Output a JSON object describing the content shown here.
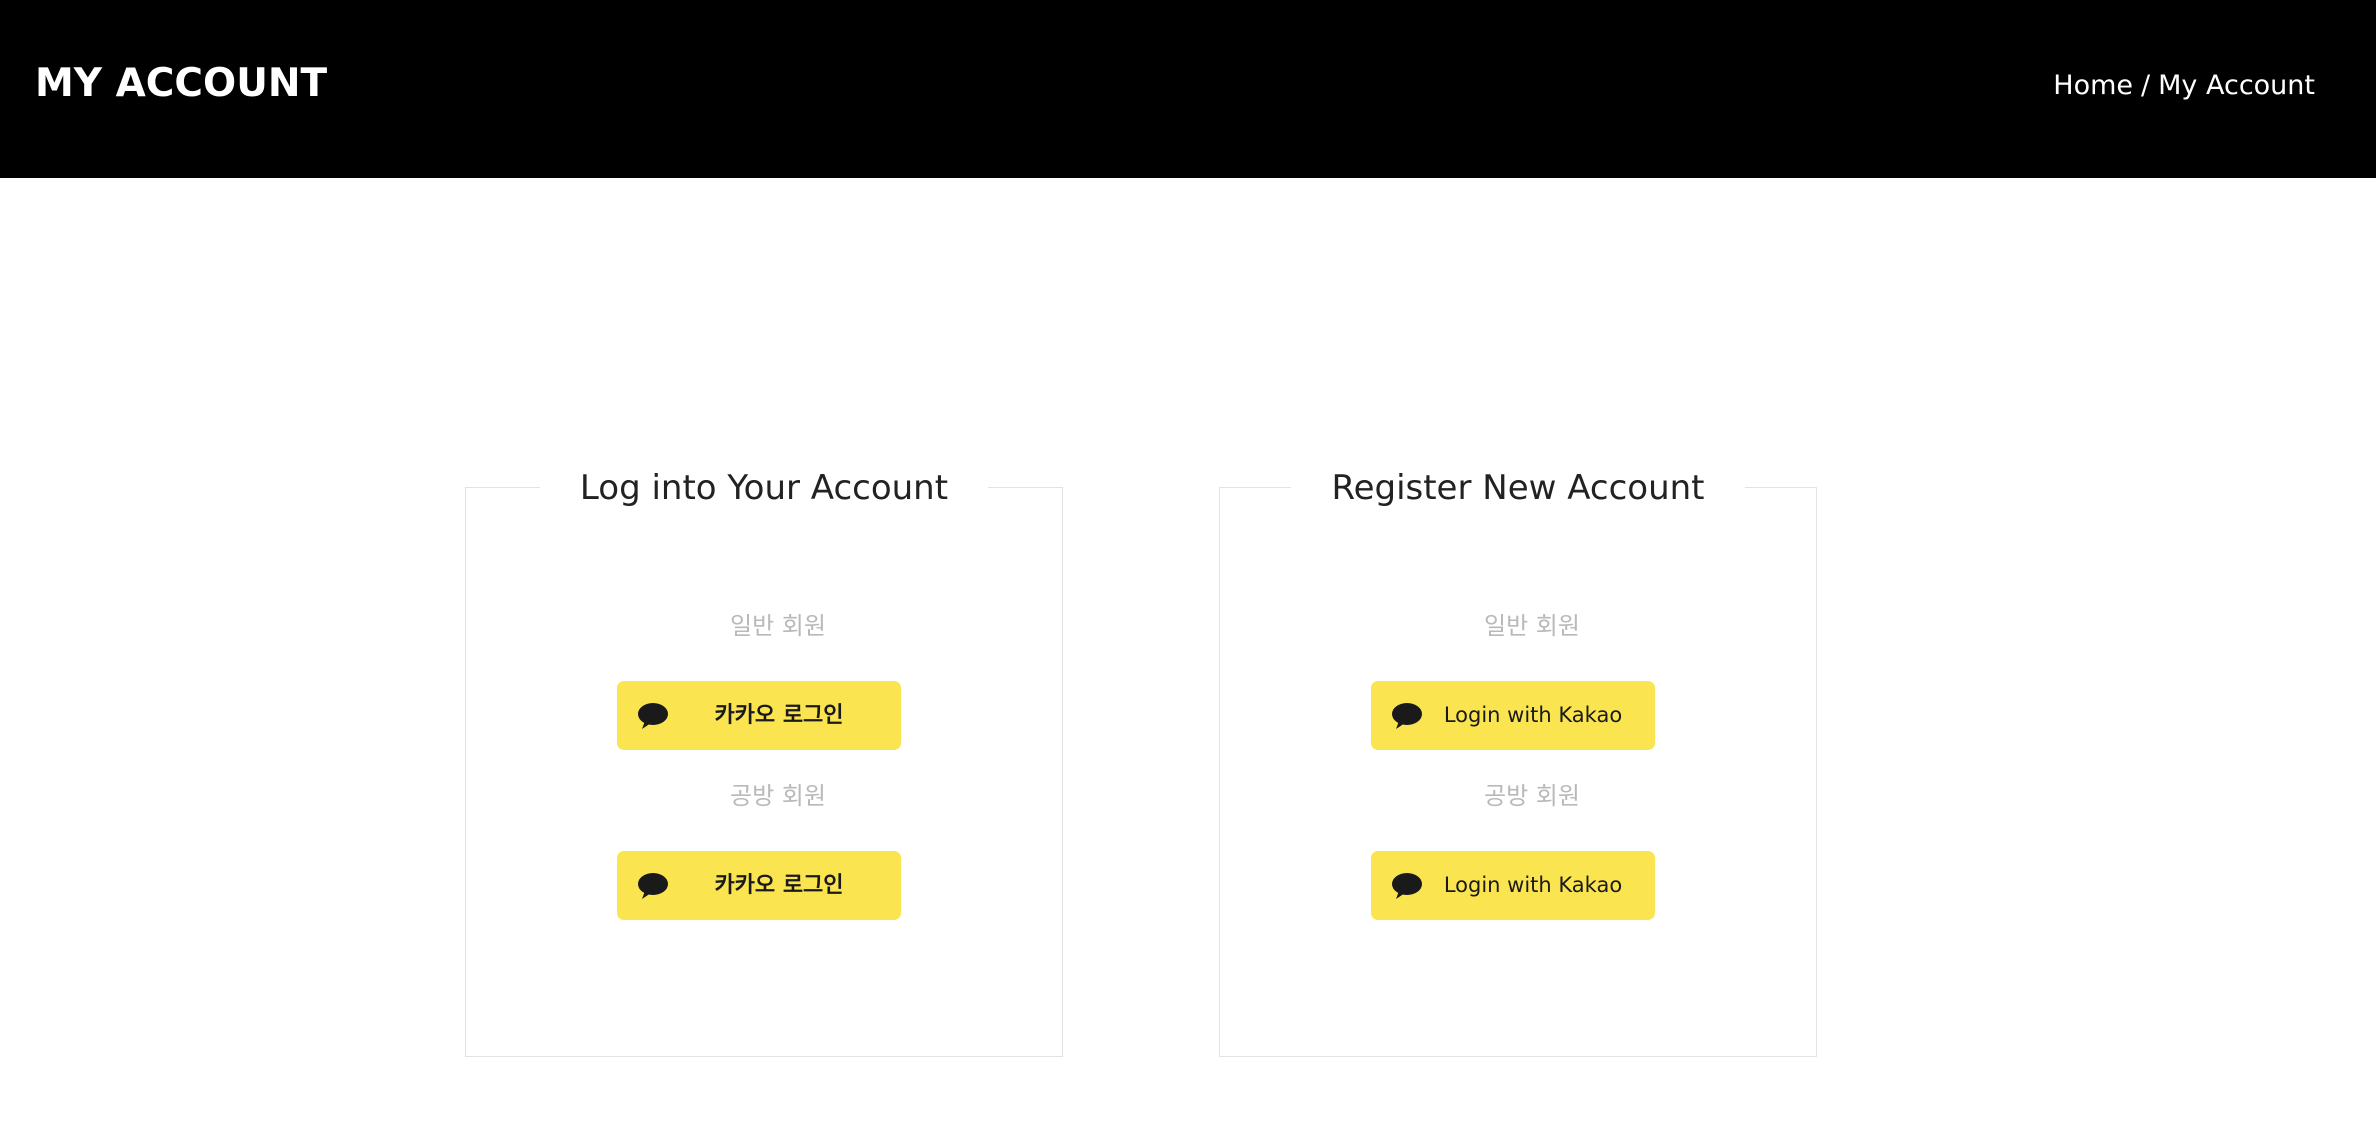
{
  "header": {
    "title": "MY ACCOUNT",
    "breadcrumb": {
      "home": "Home",
      "separator": "/",
      "current": "My Account"
    },
    "background_color": "#000000"
  },
  "login_panel": {
    "heading": "Log into Your Account",
    "general_member_label": "일반 회원",
    "general_button_label": "카카오 로그인",
    "workshop_member_label": "공방 회원",
    "workshop_button_label": "카카오 로그인"
  },
  "register_panel": {
    "heading": "Register New Account",
    "general_member_label": "일반 회원",
    "general_button_label": "Login with Kakao",
    "workshop_member_label": "공방 회원",
    "workshop_button_label": "Login with Kakao"
  },
  "colors": {
    "kakao_yellow": "#fae550",
    "label_gray": "#b9b9b9"
  },
  "icons": {
    "kakao": "speech-bubble-icon"
  }
}
